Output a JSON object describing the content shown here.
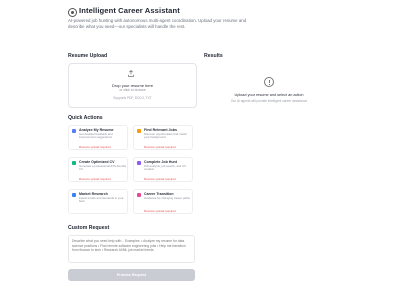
{
  "header": {
    "title": "Intelligent Career Assistant",
    "subtitle": "AI-powered job hunting with autonomous multi-agent coordination. Upload your resume and describe what you need—our specialists will handle the rest."
  },
  "upload": {
    "heading": "Resume Upload",
    "drop_text": "Drop your resume here",
    "browse_text": "or click to browse",
    "formats": "Supports PDF, DOCX, TXT"
  },
  "results": {
    "heading": "Results",
    "empty_title": "Upload your resume and select an action",
    "empty_desc": "Our AI agents will provide intelligent career assistance"
  },
  "quick_actions": {
    "heading": "Quick Actions",
    "items": [
      {
        "title": "Analyze My Resume",
        "desc": "Get detailed feedback and improvement suggestions",
        "note": "Resume upload required",
        "icon": "document-icon",
        "color": "#5b7cfa"
      },
      {
        "title": "Find Relevant Jobs",
        "desc": "Discover opportunities that match your background",
        "note": "Resume upload required",
        "icon": "search-icon",
        "color": "#f59e0b"
      },
      {
        "title": "Create Optimized CV",
        "desc": "Generate a professional ATS-friendly CV",
        "note": "Resume upload required",
        "icon": "sparkle-icon",
        "color": "#10b981"
      },
      {
        "title": "Complete Job Hunt",
        "desc": "Full analysis, job search, and CV creation",
        "note": "Resume upload required",
        "icon": "rocket-icon",
        "color": "#8b5cf6"
      },
      {
        "title": "Market Research",
        "desc": "Latest trends and demands in your field",
        "note": "",
        "icon": "chart-icon",
        "color": "#3b82f6"
      },
      {
        "title": "Career Transition",
        "desc": "Guidance for changing career paths",
        "note": "Resume upload required",
        "icon": "arrows-icon",
        "color": "#ec4899"
      }
    ]
  },
  "custom_request": {
    "heading": "Custom Request",
    "placeholder": "Describe what you need help with... Examples: • Analyze my resume for data science positions • Find remote software engineering jobs • Help me transition from finance to tech • Research AI/ML job market trends",
    "button_label": "Process Request"
  }
}
